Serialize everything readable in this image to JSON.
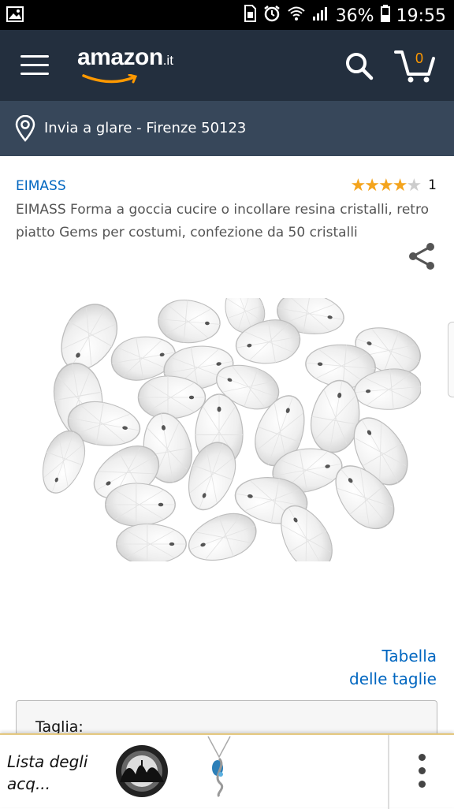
{
  "status_bar": {
    "battery": "36%",
    "time": "19:55"
  },
  "header": {
    "logo_word": "amazon",
    "logo_tld": ".it",
    "cart_count": "0"
  },
  "location": {
    "text": "Invia a glare - Firenze 50123"
  },
  "product": {
    "brand": "EIMASS",
    "rating": 4,
    "rating_max": 5,
    "rating_count": "1",
    "title": "EIMASS Forma a goccia cucire o incollare resina cristalli, retro piatto Gems per costumi, confezione da 50 cristalli"
  },
  "size_chart": {
    "line1": "Tabella",
    "line2": "delle taglie"
  },
  "size_selector": {
    "label": "Taglia:"
  },
  "bottom_bar": {
    "wishlist_line1": "Lista degli",
    "wishlist_line2": "acq..."
  },
  "colors": {
    "header_bg": "#232f3e",
    "location_bg": "#37475a",
    "link": "#0066c0",
    "star": "#f4a41d",
    "cart_count": "#ff9900"
  }
}
